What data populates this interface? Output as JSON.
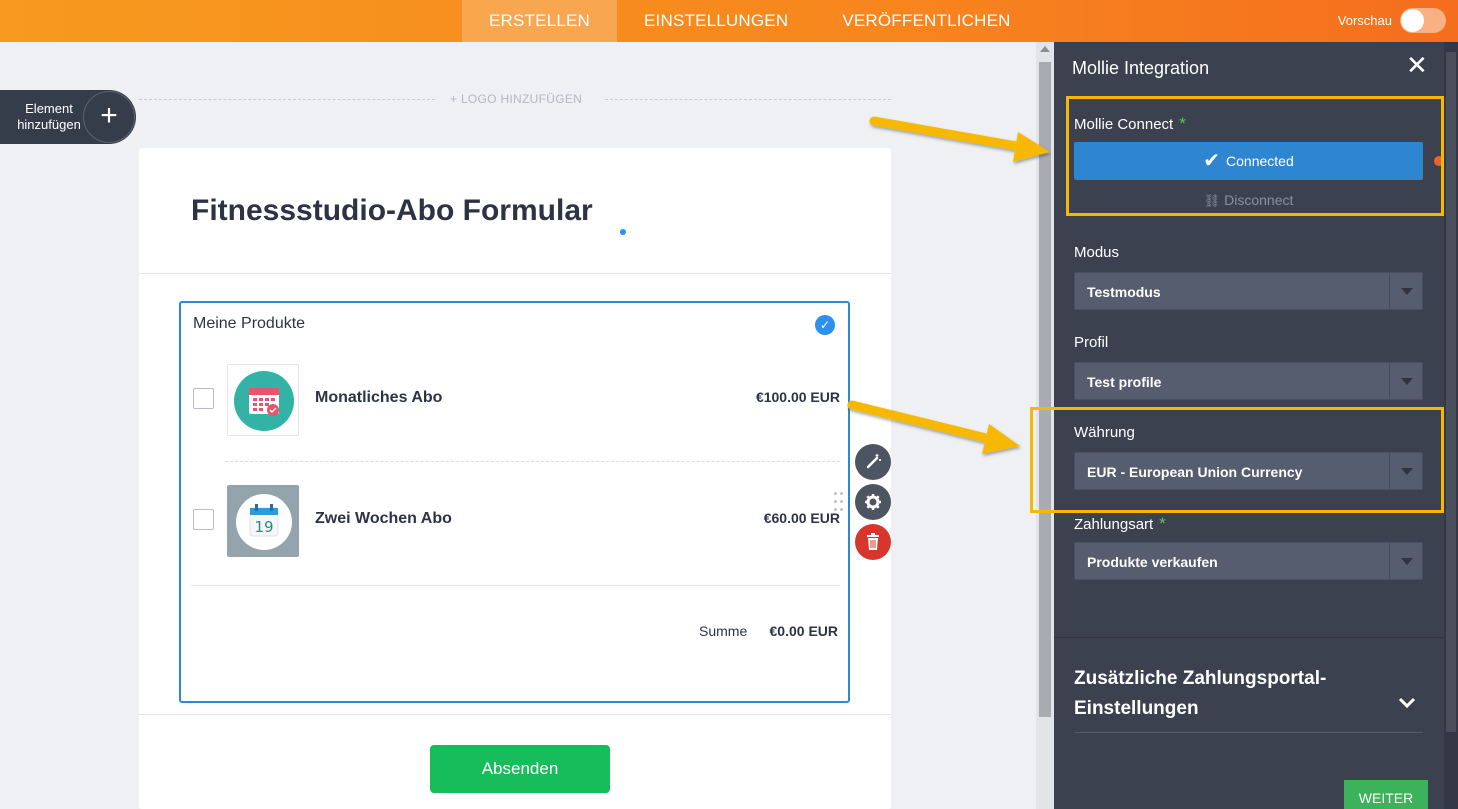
{
  "header": {
    "tabs": [
      {
        "label": "ERSTELLEN",
        "active": true
      },
      {
        "label": "EINSTELLUNGEN",
        "active": false
      },
      {
        "label": "VERÖFFENTLICHEN",
        "active": false
      }
    ],
    "preview_label": "Vorschau"
  },
  "builder": {
    "add_element_label": "Element hinzufügen",
    "add_logo_label": "+ LOGO HINZUFÜGEN",
    "form_title": "Fitnessstudio-Abo Formular",
    "products_label": "Meine Produkte",
    "products": [
      {
        "name": "Monatliches Abo",
        "price": "€100.00 EUR",
        "icon": "calendar-icon"
      },
      {
        "name": "Zwei Wochen Abo",
        "price": "€60.00 EUR",
        "icon": "calendar-19-icon"
      }
    ],
    "sum_label": "Summe",
    "sum_value": "€0.00 EUR",
    "submit_label": "Absenden"
  },
  "panel": {
    "title": "Mollie Integration",
    "connect_label": "Mollie Connect",
    "connected_label": "Connected",
    "disconnect_label": "Disconnect",
    "mode_label": "Modus",
    "mode_value": "Testmodus",
    "profile_label": "Profil",
    "profile_value": "Test profile",
    "currency_label": "Währung",
    "currency_value": "EUR - European Union Currency",
    "payment_type_label": "Zahlungsart",
    "payment_type_value": "Produkte verkaufen",
    "extra_settings_title": "Zusätzliche Zahlungsportal-Einstellungen",
    "next_label": "WEITER"
  },
  "colors": {
    "header_orange": "#f7861e",
    "accent_blue": "#2e86d1",
    "submit_green": "#18bd5b",
    "highlight_yellow": "#f6b800",
    "panel_bg": "#3c4150"
  }
}
